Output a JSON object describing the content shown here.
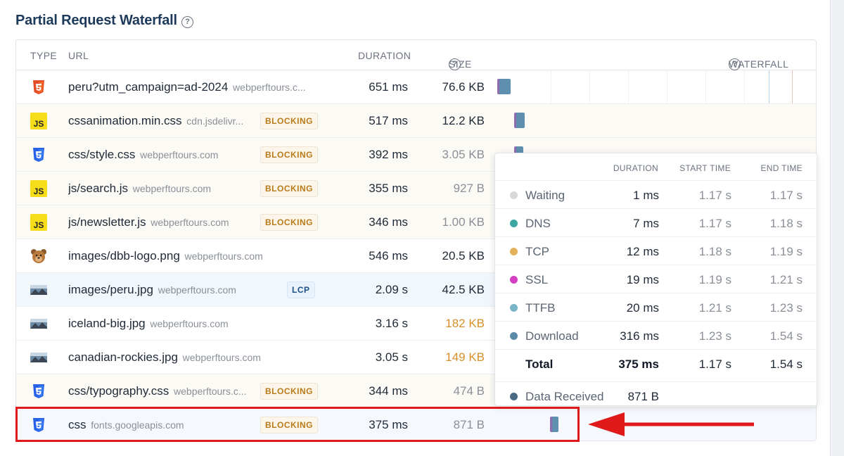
{
  "title": "Partial Request Waterfall",
  "headers": {
    "type": "TYPE",
    "url": "URL",
    "duration": "DURATION",
    "size": "SIZE",
    "waterfall": "WATERFALL"
  },
  "rows": [
    {
      "icon": "html-icon",
      "url": "peru?utm_campaign=ad-2024",
      "host": "webperftours.c...",
      "badge": "",
      "duration": "651 ms",
      "size": "76.6 KB",
      "size_style": "normal",
      "start_pct": 0.0,
      "dur_pct": 4.3
    },
    {
      "icon": "js-icon",
      "url": "cssanimation.min.css",
      "host": "cdn.jsdelivr...",
      "badge": "BLOCKING",
      "duration": "517 ms",
      "size": "12.2 KB",
      "size_style": "normal",
      "start_pct": 5.5,
      "dur_pct": 3.4
    },
    {
      "icon": "css-icon",
      "url": "css/style.css",
      "host": "webperftours.com",
      "badge": "BLOCKING",
      "duration": "392 ms",
      "size": "3.05 KB",
      "size_style": "muted",
      "start_pct": 5.5,
      "dur_pct": 3.0
    },
    {
      "icon": "js-icon",
      "url": "js/search.js",
      "host": "webperftours.com",
      "badge": "BLOCKING",
      "duration": "355 ms",
      "size": "927 B",
      "size_style": "muted",
      "start_pct": 0,
      "dur_pct": 0
    },
    {
      "icon": "js-icon",
      "url": "js/newsletter.js",
      "host": "webperftours.com",
      "badge": "BLOCKING",
      "duration": "346 ms",
      "size": "1.00 KB",
      "size_style": "muted",
      "start_pct": 0,
      "dur_pct": 0
    },
    {
      "icon": "dog-logo-icon",
      "url": "images/dbb-logo.png",
      "host": "webperftours.com",
      "badge": "",
      "duration": "546 ms",
      "size": "20.5 KB",
      "size_style": "normal",
      "start_pct": 0,
      "dur_pct": 0
    },
    {
      "icon": "image-thumb-icon",
      "url": "images/peru.jpg",
      "host": "webperftours.com",
      "badge": "LCP",
      "duration": "2.09 s",
      "size": "42.5 KB",
      "size_style": "normal",
      "start_pct": 0,
      "dur_pct": 0
    },
    {
      "icon": "image-thumb-icon",
      "url": "iceland-big.jpg",
      "host": "webperftours.com",
      "badge": "",
      "duration": "3.16 s",
      "size": "182 KB",
      "size_style": "warn",
      "start_pct": 0,
      "dur_pct": 0
    },
    {
      "icon": "image-thumb-icon",
      "url": "canadian-rockies.jpg",
      "host": "webperftours.com",
      "badge": "",
      "duration": "3.05 s",
      "size": "149 KB",
      "size_style": "warn",
      "start_pct": 0,
      "dur_pct": 0
    },
    {
      "icon": "css-icon",
      "url": "css/typography.css",
      "host": "webperftours.c...",
      "badge": "BLOCKING",
      "duration": "344 ms",
      "size": "474 B",
      "size_style": "muted",
      "start_pct": 0,
      "dur_pct": 0
    },
    {
      "icon": "css-icon",
      "url": "css",
      "host": "fonts.googleapis.com",
      "badge": "BLOCKING",
      "duration": "375 ms",
      "size": "871 B",
      "size_style": "muted",
      "start_pct": 17.1,
      "dur_pct": 2.6
    }
  ],
  "tooltip": {
    "headers": {
      "duration": "DURATION",
      "start": "START TIME",
      "end": "END TIME"
    },
    "phases": [
      {
        "label": "Waiting",
        "color": "#d9d9d9",
        "duration": "1 ms",
        "start": "1.17 s",
        "end": "1.17 s"
      },
      {
        "label": "DNS",
        "color": "#3aa8a0",
        "duration": "7 ms",
        "start": "1.17 s",
        "end": "1.18 s"
      },
      {
        "label": "TCP",
        "color": "#e3b25a",
        "duration": "12 ms",
        "start": "1.18 s",
        "end": "1.19 s"
      },
      {
        "label": "SSL",
        "color": "#d33fc0",
        "duration": "19 ms",
        "start": "1.19 s",
        "end": "1.21 s"
      },
      {
        "label": "TTFB",
        "color": "#7ab4c8",
        "duration": "20 ms",
        "start": "1.21 s",
        "end": "1.23 s"
      },
      {
        "label": "Download",
        "color": "#5b8aa8",
        "duration": "316 ms",
        "start": "1.23 s",
        "end": "1.54 s"
      }
    ],
    "total": {
      "label": "Total",
      "duration": "375 ms",
      "start": "1.17 s",
      "end": "1.54 s"
    },
    "received": {
      "label": "Data Received",
      "color": "#4a6a86",
      "value": "871 B"
    }
  },
  "colors": {
    "highlight": "#e01a1a",
    "bar": "#5f8fae",
    "bar_edge": "#8e6cb0"
  }
}
